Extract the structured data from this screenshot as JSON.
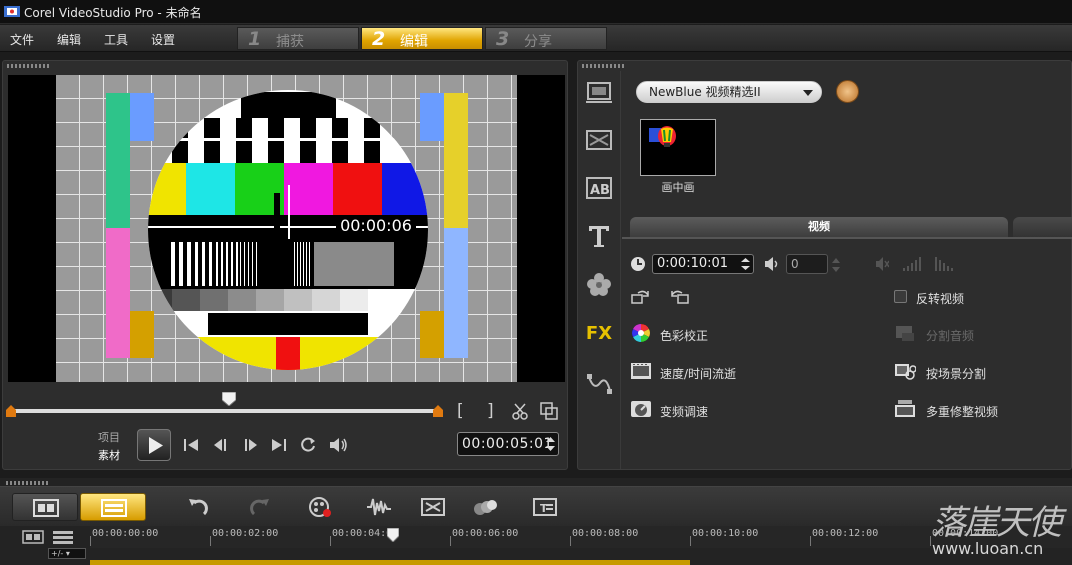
{
  "window": {
    "title": "Corel VideoStudio Pro - 未命名"
  },
  "menu": {
    "items": [
      "文件",
      "编辑",
      "工具",
      "设置"
    ]
  },
  "steps": [
    {
      "num": "1",
      "label": "捕获",
      "active": false
    },
    {
      "num": "2",
      "label": "编辑",
      "active": true
    },
    {
      "num": "3",
      "label": "分享",
      "active": false
    }
  ],
  "preview": {
    "overlay_timecode": "00:00:06",
    "mode_project": "项目",
    "mode_clip": "素材",
    "timecode": "00:00:05:01",
    "scrub_position": 0.51,
    "controls": {
      "mark_in": "[",
      "mark_out": "]"
    }
  },
  "library": {
    "dropdown": "NewBlue 视频精选II",
    "thumbnail_label": "画中画",
    "side_icons": [
      "media-icon",
      "transition-icon",
      "title-ab-icon",
      "text-t-icon",
      "graphic-flower-icon",
      "fx-icon",
      "path-icon"
    ],
    "fx_label": "FX"
  },
  "options": {
    "tab_label": "视频",
    "duration": "0:00:10:01",
    "volume": "0",
    "reverse_video": "反转视频",
    "color_correction": "色彩校正",
    "split_audio": "分割音频",
    "speed_time_lapse": "速度/时间流逝",
    "split_by_scene": "按场景分割",
    "variable_speed": "变频调速",
    "multi_trim": "多重修整视频"
  },
  "timeline": {
    "ruler": [
      "00:00:00:00",
      "00:00:02:00",
      "00:00:04:00",
      "00:00:06:00",
      "00:00:08:00",
      "00:00:10:00",
      "00:00:12:00",
      "00:00:14:00"
    ],
    "zoom": "+/-"
  },
  "watermark": {
    "logo": "落崖天使",
    "url": "www.luoan.cn"
  },
  "colors": {
    "accent": "#e0a400",
    "background": "#1c1c1c"
  }
}
